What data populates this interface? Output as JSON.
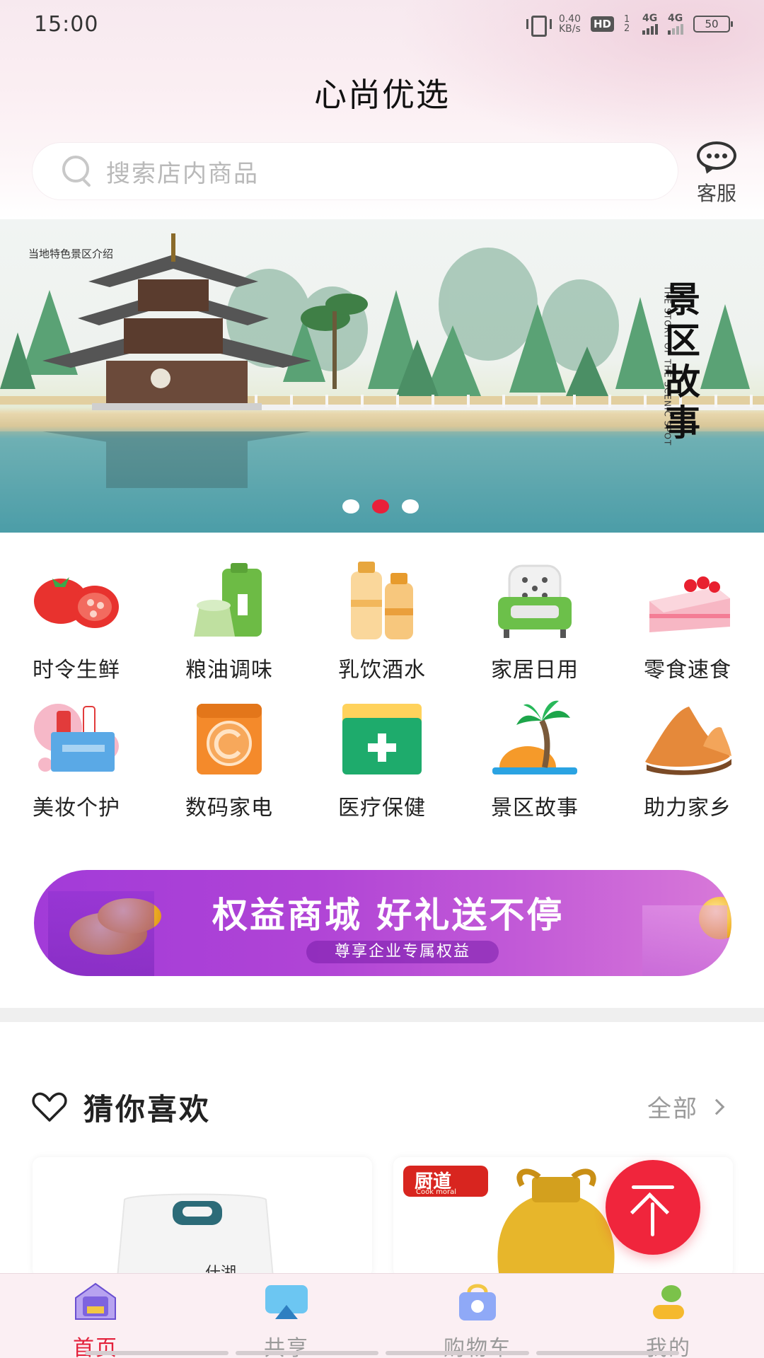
{
  "status_bar": {
    "time": "15:00",
    "speed_value": "0.40",
    "speed_unit": "KB/s",
    "hd_label": "HD",
    "hd_sub": "1 2",
    "network_1": "4G",
    "network_2": "4G",
    "battery": "50"
  },
  "header": {
    "title": "心尚优选",
    "search_placeholder": "搜索店内商品",
    "service_label": "客服"
  },
  "banner": {
    "caption": "当地特色景区介绍",
    "title": "景区故事",
    "subtitle": "THE STORY OF THE SCENIC SPOT",
    "active_slide": 2,
    "slide_count": 3
  },
  "categories": [
    {
      "label": "时令生鲜",
      "icon": "tomato-icon"
    },
    {
      "label": "粮油调味",
      "icon": "grain-oil-icon"
    },
    {
      "label": "乳饮酒水",
      "icon": "bottles-icon"
    },
    {
      "label": "家居日用",
      "icon": "sofa-icon"
    },
    {
      "label": "零食速食",
      "icon": "cake-icon"
    },
    {
      "label": "美妆个护",
      "icon": "cosmetics-icon"
    },
    {
      "label": "数码家电",
      "icon": "washing-machine-icon"
    },
    {
      "label": "医疗保健",
      "icon": "medical-kit-icon"
    },
    {
      "label": "景区故事",
      "icon": "palm-island-icon"
    },
    {
      "label": "助力家乡",
      "icon": "mountain-icon"
    }
  ],
  "promo": {
    "title": "权益商城 好礼送不停",
    "subtitle": "尊享企业专属权益"
  },
  "recommend": {
    "title": "猜你喜欢",
    "see_all": "全部"
  },
  "products": [
    {
      "brand_text": "什湖",
      "image": "rice-bag-image"
    },
    {
      "brand_text": "厨道",
      "brand_sub": "Cook moral",
      "image": "cooking-oil-image"
    }
  ],
  "tabbar": {
    "items": [
      {
        "label": "首页",
        "icon": "home-icon",
        "active": true
      },
      {
        "label": "共享",
        "icon": "share-icon",
        "active": false
      },
      {
        "label": "购物车",
        "icon": "cart-icon",
        "active": false
      },
      {
        "label": "我的",
        "icon": "profile-icon",
        "active": false
      }
    ]
  },
  "colors": {
    "accent": "#e3213b",
    "promo_purple": "#b044d6",
    "header_pink": "#f7e9ef"
  }
}
